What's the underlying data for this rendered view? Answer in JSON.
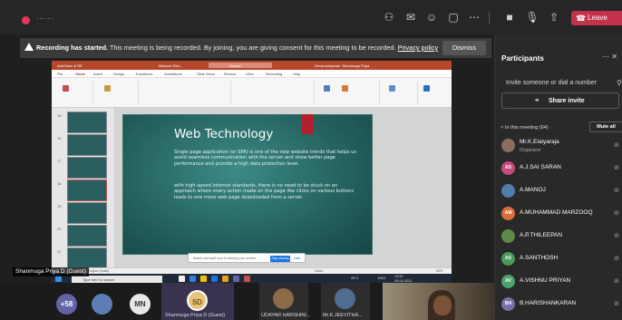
{
  "top_bar": {
    "leave_label": "Leave",
    "colors": {
      "leave": "#c4314b",
      "app_accent": "#e4395b"
    },
    "icons": [
      "participants-icon",
      "chat-icon",
      "reactions-icon",
      "rooms-icon",
      "more-icon",
      "camera-icon",
      "mic-off-icon",
      "share-tray-icon"
    ]
  },
  "banner": {
    "title": "Recording has started.",
    "message": "This meeting is being recorded. By joining, you are giving consent for this meeting to be recorded.",
    "link": "Privacy policy",
    "dismiss_label": "Dismiss"
  },
  "shared_screen": {
    "app_title": "Network Res...",
    "search_label": "Search",
    "user_label": "Devanarayanan. Shanmuga Priya",
    "share_label": "Share",
    "comments_label": "Comments",
    "tabs": [
      "File",
      "Home",
      "Insert",
      "Design",
      "Transitions",
      "Animations",
      "Slide Show",
      "Review",
      "View",
      "Recording",
      "Help"
    ],
    "thumbnail_numbers": [
      "15",
      "16",
      "17",
      "18",
      "19",
      "20",
      "21"
    ],
    "slide": {
      "title": "Web Technology",
      "paragraph1": "Single page application (or SPA) is one of the new website trends that helps us avoid seamless communication with the server and show better page performance and provide a high data protection level.",
      "paragraph2": "with high-speed Internet standards, there is no need to be stuck on an approach where every action made on the page like clicks on various buttons leads to one more web page downloaded from a server."
    },
    "share_notice": {
      "text": "teams.microsoft.com is sharing your screen.",
      "stop_label": "Stop sharing",
      "hide_label": "Hide"
    },
    "status_left": "Slide 18 of 30",
    "status_lang": "English (India)",
    "notes_label": "Notes",
    "zoom_label": "83%",
    "taskbar": {
      "search_placeholder": "Type here to search",
      "weather": "26°C",
      "lang": "ENG",
      "time": "13:20",
      "date": "05-04-2021"
    }
  },
  "presenter_tag": "Shanmuga Priya D (Guest)",
  "gallery": [
    {
      "initials": "+58",
      "color": "#6264a7",
      "kind": "more"
    },
    {
      "initials": "",
      "color": "#5b7fb3",
      "kind": "photo"
    },
    {
      "initials": "MN",
      "color": "#e8e8e8",
      "kind": "initials"
    },
    {
      "initials": "SD",
      "color": "#e8c37a",
      "kind": "presenter",
      "name": "Shanmuga Priya D (Guest)"
    },
    {
      "initials": "",
      "color": "#8b6b4a",
      "kind": "photo",
      "name": "UDAYAR HARSHINI..."
    },
    {
      "initials": "",
      "color": "#4f6d8f",
      "kind": "photo",
      "name": "Mr.K.JEEVITHA..."
    }
  ],
  "panel": {
    "title": "Participants",
    "invite_placeholder": "Invite someone or dial a number",
    "share_invite_label": "Share invite",
    "section_label": "In this meeting (64)",
    "mute_all_label": "Mute all",
    "participants": [
      {
        "name": "Mr.K.Elaiyaraja",
        "role": "Organizer",
        "initials": "KE",
        "color": "#8a6d5a",
        "kind": "photo"
      },
      {
        "name": "A.J.SAI SARAN",
        "role": "",
        "initials": "AS",
        "color": "#c84b7e",
        "kind": "initials"
      },
      {
        "name": "A.MANOJ",
        "role": "",
        "initials": "AM",
        "color": "#4f7dac",
        "kind": "photo"
      },
      {
        "name": "A.MUHAMMAD MARZOOQ",
        "role": "",
        "initials": "AM",
        "color": "#d86f3b",
        "kind": "initials"
      },
      {
        "name": "A.P.THILEEPAN",
        "role": "",
        "initials": "AT",
        "color": "#5c8a4a",
        "kind": "photo"
      },
      {
        "name": "A.SANTHOSH",
        "role": "",
        "initials": "AS",
        "color": "#4a9a5a",
        "kind": "initials"
      },
      {
        "name": "A.VISHNU PRIYAN",
        "role": "",
        "initials": "AV",
        "color": "#4aa36c",
        "kind": "initials"
      },
      {
        "name": "B.HARISHANKARAN",
        "role": "",
        "initials": "BH",
        "color": "#7a6fa8",
        "kind": "initials"
      }
    ]
  }
}
